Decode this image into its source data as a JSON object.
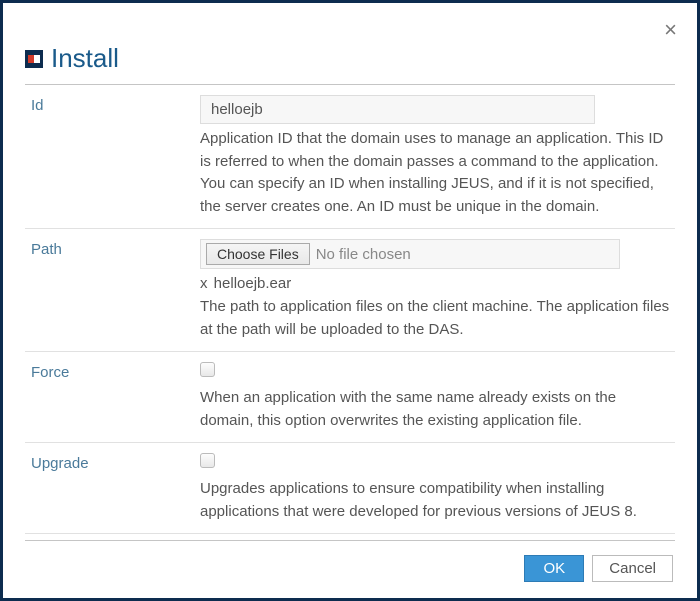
{
  "dialog": {
    "title": "Install"
  },
  "fields": {
    "id": {
      "label": "Id",
      "value": "helloejb",
      "help": "Application ID that the domain uses to manage an application. This ID is referred to when the domain passes a command to the application. You can specify an ID when installing JEUS, and if it is not specified, the server creates one. An ID must be unique in the domain."
    },
    "path": {
      "label": "Path",
      "chooseLabel": "Choose Files",
      "noFile": "No file chosen",
      "selected_prefix": "x",
      "selected_name": "helloejb.ear",
      "help": "The path to application files on the client machine. The application files at the path will be uploaded to the DAS."
    },
    "force": {
      "label": "Force",
      "help": "When an application with the same name already exists on the domain, this option overwrites the existing application file."
    },
    "upgrade": {
      "label": "Upgrade",
      "help": "Upgrades applications to ensure compatibility when installing applications that were developed for previous versions of JEUS 8."
    }
  },
  "buttons": {
    "ok": "OK",
    "cancel": "Cancel"
  }
}
